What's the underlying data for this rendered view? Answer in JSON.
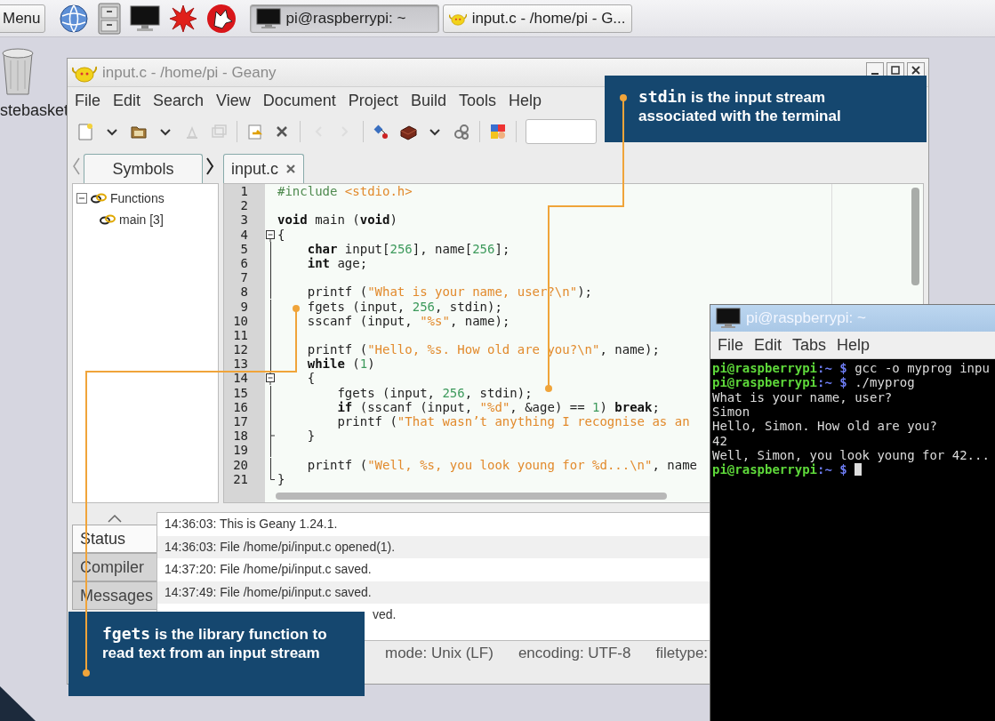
{
  "taskbar": {
    "menu_button": "Menu",
    "tasks": [
      {
        "kind": "terminal",
        "label": "pi@raspberrypi: ~",
        "selected": true
      },
      {
        "kind": "editor",
        "label": "input.c - /home/pi - G...",
        "selected": false
      }
    ]
  },
  "desktop_icons": [
    {
      "label": "stebasket"
    }
  ],
  "geany": {
    "title": "input.c - /home/pi - Geany",
    "menu": [
      "File",
      "Edit",
      "Search",
      "View",
      "Document",
      "Project",
      "Build",
      "Tools",
      "Help"
    ],
    "sidebar_tab": "Symbols",
    "editor_tab": "input.c",
    "symbols": [
      {
        "label": "Functions",
        "expanded": true,
        "children": [
          {
            "label": "main [3]"
          }
        ]
      }
    ],
    "code_lines": [
      {
        "number": "1",
        "fold_open": false,
        "fold_close": false,
        "segments": [
          {
            "kind": "directive",
            "text": "#include"
          },
          {
            "kind": "header",
            "text": " <stdio.h>"
          }
        ]
      },
      {
        "number": "2",
        "fold_open": false,
        "fold_close": false
      },
      {
        "number": "3",
        "fold_open": false,
        "fold_close": false,
        "segments": [
          {
            "kind": "keyword",
            "text": "void"
          },
          {
            "kind": "plain",
            "text": " main ("
          },
          {
            "kind": "keyword",
            "text": "void"
          },
          {
            "kind": "plain",
            "text": ")"
          }
        ]
      },
      {
        "number": "4",
        "fold_open": true,
        "fold_close": false,
        "segments": [
          {
            "kind": "plain",
            "text": "{"
          }
        ]
      },
      {
        "number": "5",
        "fold_open": false,
        "fold_close": false,
        "segments": [
          {
            "kind": "keyword",
            "text": "    char"
          },
          {
            "kind": "plain",
            "text": " input["
          },
          {
            "kind": "number",
            "text": "256"
          },
          {
            "kind": "plain",
            "text": "], name["
          },
          {
            "kind": "number",
            "text": "256"
          },
          {
            "kind": "plain",
            "text": "];"
          }
        ]
      },
      {
        "number": "6",
        "fold_open": false,
        "fold_close": false,
        "segments": [
          {
            "kind": "keyword",
            "text": "    int"
          },
          {
            "kind": "plain",
            "text": " age;"
          }
        ]
      },
      {
        "number": "7",
        "fold_open": false,
        "fold_close": false
      },
      {
        "number": "8",
        "fold_open": false,
        "fold_close": false,
        "segments": [
          {
            "kind": "plain",
            "text": "    printf ("
          },
          {
            "kind": "string",
            "text": "\"What is your name, user?\\n\""
          },
          {
            "kind": "plain",
            "text": ");"
          }
        ]
      },
      {
        "number": "9",
        "fold_open": false,
        "fold_close": false,
        "segments": [
          {
            "kind": "plain",
            "text": "    fgets (input, "
          },
          {
            "kind": "number",
            "text": "256"
          },
          {
            "kind": "plain",
            "text": ", stdin);"
          }
        ]
      },
      {
        "number": "10",
        "fold_open": false,
        "fold_close": false,
        "segments": [
          {
            "kind": "plain",
            "text": "    sscanf (input, "
          },
          {
            "kind": "string",
            "text": "\"%s\""
          },
          {
            "kind": "plain",
            "text": ", name);"
          }
        ]
      },
      {
        "number": "11",
        "fold_open": false,
        "fold_close": false
      },
      {
        "number": "12",
        "fold_open": false,
        "fold_close": false,
        "segments": [
          {
            "kind": "plain",
            "text": "    printf ("
          },
          {
            "kind": "string",
            "text": "\"Hello, %s. How old are you?\\n\""
          },
          {
            "kind": "plain",
            "text": ", name);"
          }
        ]
      },
      {
        "number": "13",
        "fold_open": false,
        "fold_close": false,
        "segments": [
          {
            "kind": "keyword",
            "text": "    while"
          },
          {
            "kind": "plain",
            "text": " ("
          },
          {
            "kind": "number",
            "text": "1"
          },
          {
            "kind": "plain",
            "text": ")"
          }
        ]
      },
      {
        "number": "14",
        "fold_open": true,
        "fold_close": false,
        "segments": [
          {
            "kind": "plain",
            "text": "    {"
          }
        ]
      },
      {
        "number": "15",
        "fold_open": false,
        "fold_close": false,
        "segments": [
          {
            "kind": "plain",
            "text": "        fgets (input, "
          },
          {
            "kind": "number",
            "text": "256"
          },
          {
            "kind": "plain",
            "text": ", stdin);"
          }
        ]
      },
      {
        "number": "16",
        "fold_open": false,
        "fold_close": false,
        "segments": [
          {
            "kind": "keyword",
            "text": "        if"
          },
          {
            "kind": "plain",
            "text": " (sscanf (input, "
          },
          {
            "kind": "string",
            "text": "\"%d\""
          },
          {
            "kind": "plain",
            "text": ", &age) == "
          },
          {
            "kind": "number",
            "text": "1"
          },
          {
            "kind": "plain",
            "text": ") "
          },
          {
            "kind": "keyword",
            "text": "break"
          },
          {
            "kind": "plain",
            "text": ";"
          }
        ]
      },
      {
        "number": "17",
        "fold_open": false,
        "fold_close": false,
        "segments": [
          {
            "kind": "plain",
            "text": "        printf ("
          },
          {
            "kind": "string",
            "text": "\"That wasn’t anything I recognise as an"
          }
        ]
      },
      {
        "number": "18",
        "fold_open": false,
        "fold_close": true,
        "segments": [
          {
            "kind": "plain",
            "text": "    }"
          }
        ]
      },
      {
        "number": "19",
        "fold_open": false,
        "fold_close": false
      },
      {
        "number": "20",
        "fold_open": false,
        "fold_close": false,
        "segments": [
          {
            "kind": "plain",
            "text": "    printf ("
          },
          {
            "kind": "string",
            "text": "\"Well, %s, you look young for %d...\\n\""
          },
          {
            "kind": "plain",
            "text": ", name"
          }
        ]
      },
      {
        "number": "21",
        "fold_open": false,
        "fold_close": true,
        "segments": [
          {
            "kind": "plain",
            "text": "}"
          }
        ]
      }
    ],
    "panel_tabs": [
      {
        "label": "Status",
        "selected": true
      },
      {
        "label": "Compiler",
        "selected": false
      },
      {
        "label": "Messages",
        "selected": false
      }
    ],
    "log": [
      {
        "kind": "full",
        "text": "14:36:03: This is Geany 1.24.1."
      },
      {
        "kind": "full",
        "text": "14:36:03: File /home/pi/input.c opened(1)."
      },
      {
        "kind": "full",
        "text": "14:37:20: File /home/pi/input.c saved."
      },
      {
        "kind": "full",
        "text": "14:37:49: File /home/pi/input.c saved."
      },
      {
        "kind": "cut",
        "text": "ved."
      }
    ],
    "status_bar": [
      "mode: Unix (LF)",
      "encoding: UTF-8",
      "filetype:"
    ]
  },
  "terminal": {
    "title": "pi@raspberrypi: ~",
    "menu": [
      "File",
      "Edit",
      "Tabs",
      "Help"
    ],
    "lines": [
      {
        "cursor": false,
        "segments": [
          {
            "kind": "user",
            "text": "pi@raspberrypi"
          },
          {
            "kind": "path",
            "text": ":~ $"
          },
          {
            "kind": "plain",
            "text": " gcc -o myprog inpu"
          }
        ]
      },
      {
        "cursor": false,
        "segments": [
          {
            "kind": "user",
            "text": "pi@raspberrypi"
          },
          {
            "kind": "path",
            "text": ":~ $"
          },
          {
            "kind": "plain",
            "text": " ./myprog"
          }
        ]
      },
      {
        "cursor": false,
        "segments": [
          {
            "kind": "plain",
            "text": "What is your name, user?"
          }
        ]
      },
      {
        "cursor": false,
        "segments": [
          {
            "kind": "plain",
            "text": "Simon"
          }
        ]
      },
      {
        "cursor": false,
        "segments": [
          {
            "kind": "plain",
            "text": "Hello, Simon. How old are you?"
          }
        ]
      },
      {
        "cursor": false,
        "segments": [
          {
            "kind": "plain",
            "text": "42"
          }
        ]
      },
      {
        "cursor": false,
        "segments": [
          {
            "kind": "plain",
            "text": "Well, Simon, you look young for 42..."
          }
        ]
      },
      {
        "cursor": true,
        "segments": [
          {
            "kind": "user",
            "text": "pi@raspberrypi"
          },
          {
            "kind": "path",
            "text": ":~ $"
          }
        ]
      }
    ]
  },
  "callouts": [
    {
      "code": "stdin",
      "text": "is the input stream associated with the terminal"
    },
    {
      "code": "fgets",
      "text": "is the library function to read text from an input stream"
    }
  ]
}
